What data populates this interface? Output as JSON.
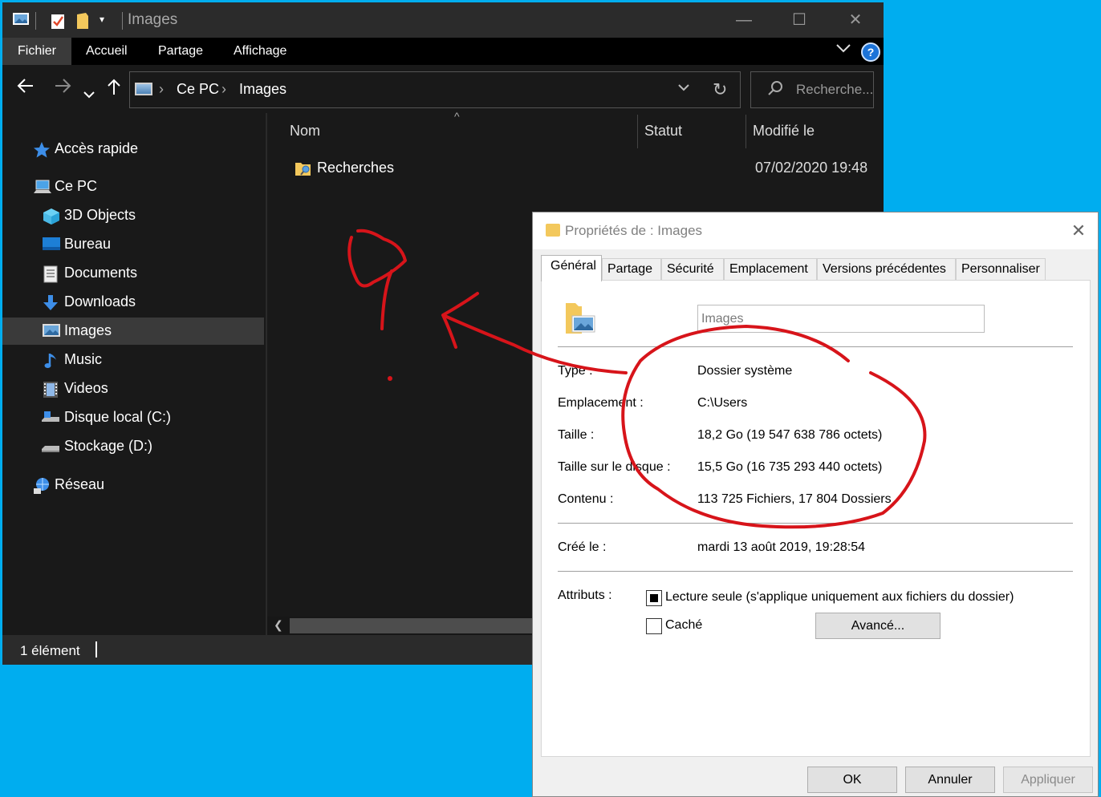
{
  "explorer": {
    "title": "Images",
    "ribbon_tabs": [
      "Fichier",
      "Accueil",
      "Partage",
      "Affichage"
    ],
    "help_label": "?",
    "address": {
      "segments": [
        "Ce PC",
        "Images"
      ]
    },
    "search_placeholder": "Recherche...",
    "nav": {
      "quick_access": "Accès rapide",
      "this_pc": "Ce PC",
      "items": [
        "3D Objects",
        "Bureau",
        "Documents",
        "Downloads",
        "Images",
        "Music",
        "Videos",
        "Disque local (C:)",
        "Stockage (D:)"
      ],
      "network": "Réseau",
      "selected": "Images"
    },
    "columns": {
      "name": "Nom",
      "status": "Statut",
      "modified": "Modifié le"
    },
    "files": [
      {
        "name": "Recherches",
        "modified": "07/02/2020 19:48"
      }
    ],
    "status": "1 élément"
  },
  "properties": {
    "title": "Propriétés de : Images",
    "tabs": [
      "Général",
      "Partage",
      "Sécurité",
      "Emplacement",
      "Versions précédentes",
      "Personnaliser"
    ],
    "active_tab": "Général",
    "name_value": "Images",
    "rows": {
      "type": {
        "label": "Type :",
        "value": "Dossier système"
      },
      "location": {
        "label": "Emplacement :",
        "value": "C:\\Users"
      },
      "size": {
        "label": "Taille :",
        "value": "18,2 Go (19 547 638 786 octets)"
      },
      "size_on_disk": {
        "label": "Taille sur le disque :",
        "value": "15,5 Go (16 735 293 440 octets)"
      },
      "contents": {
        "label": "Contenu :",
        "value": "113 725 Fichiers, 17 804 Dossiers"
      },
      "created": {
        "label": "Créé le :",
        "value": "mardi 13 août 2019, 19:28:54"
      }
    },
    "attributes_label": "Attributs :",
    "readonly_label": "Lecture seule (s'applique uniquement aux fichiers du dossier)",
    "hidden_label": "Caché",
    "advanced_label": "Avancé...",
    "buttons": {
      "ok": "OK",
      "cancel": "Annuler",
      "apply": "Appliquer"
    }
  },
  "colors": {
    "desktop": "#00adef",
    "explorer_bg": "#191919",
    "annotation": "#d7141a"
  }
}
